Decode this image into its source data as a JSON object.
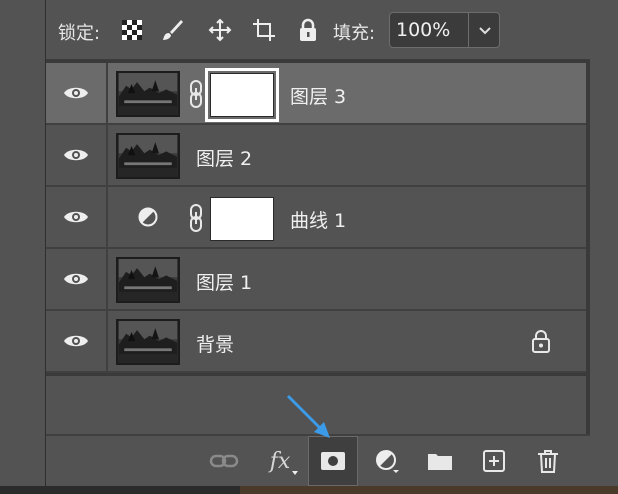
{
  "lockbar": {
    "lock_label": "锁定:",
    "fill_label": "填充:",
    "fill_value": "100%"
  },
  "layers": [
    {
      "name": "图层 3",
      "type": "pixel-with-mask",
      "selected": true
    },
    {
      "name": "图层 2",
      "type": "pixel",
      "selected": false
    },
    {
      "name": "曲线 1",
      "type": "adjustment-with-mask",
      "selected": false
    },
    {
      "name": "图层 1",
      "type": "pixel",
      "selected": false
    },
    {
      "name": "背景",
      "type": "background-locked",
      "selected": false
    }
  ],
  "toolbar": {
    "fx_label": "fx",
    "buttons": [
      "link-layers",
      "layer-style",
      "add-mask",
      "adjustment",
      "group",
      "new-layer",
      "delete"
    ],
    "pressed": "add-mask"
  },
  "colors": {
    "panel": "#535353",
    "selected_row": "#6b6b6b",
    "annotation_arrow": "#3b9be8"
  }
}
